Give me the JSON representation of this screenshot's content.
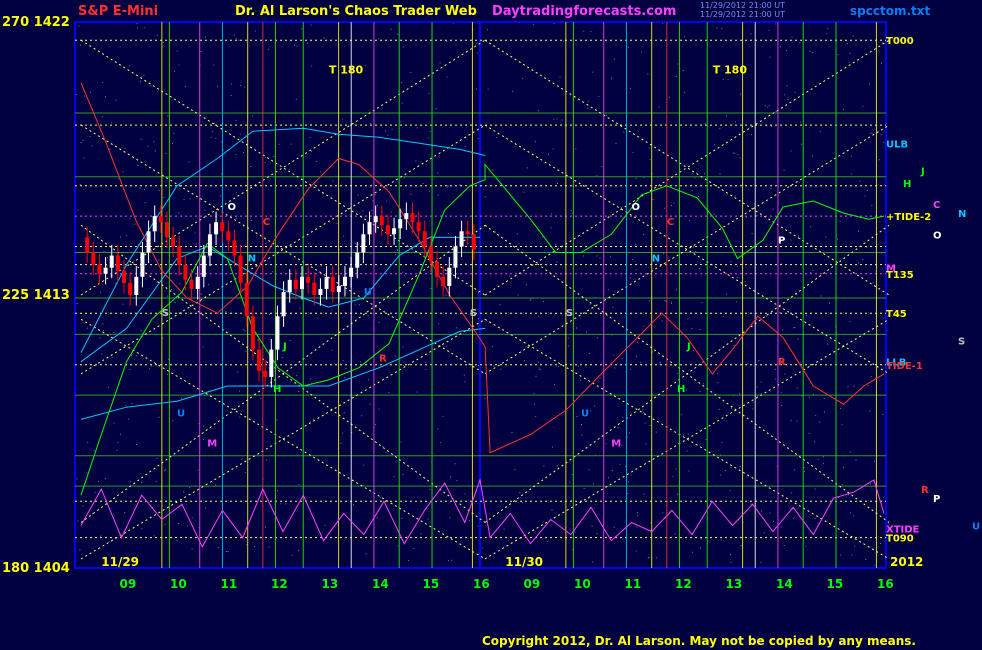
{
  "header": {
    "instrument": "S&P E-Mini",
    "title": "Dr. Al Larson's Chaos Trader Web",
    "site": "Daytradingforecasts.com",
    "file": "spcctom.txt",
    "timestamp1": "11/29/2012 21:00 UT",
    "timestamp2": "11/29/2012 21:00 UT"
  },
  "footer": {
    "copyright": "Copyright 2012, Dr. Al Larson. May not be copied by any means."
  },
  "colors": {
    "bg": "#000040",
    "frame": "#0000ff",
    "price": "#ffffff",
    "down": "#ff0000",
    "title": "#ffff00",
    "instrument": "#ff3030",
    "site": "#ff40ff"
  },
  "chart_data": {
    "type": "candlestick",
    "y_axis_labels": [
      {
        "label": "270  1422",
        "value": 1422
      },
      {
        "label": "225  1413",
        "value": 1413
      },
      {
        "label": "180  1404",
        "value": 1404
      }
    ],
    "ylim": [
      1404,
      1422
    ],
    "x_hours": [
      {
        "label": "09",
        "day": 0,
        "hour": 9
      },
      {
        "label": "10",
        "day": 0,
        "hour": 10
      },
      {
        "label": "11",
        "day": 0,
        "hour": 11
      },
      {
        "label": "12",
        "day": 0,
        "hour": 12
      },
      {
        "label": "13",
        "day": 0,
        "hour": 13
      },
      {
        "label": "14",
        "day": 0,
        "hour": 14
      },
      {
        "label": "15",
        "day": 0,
        "hour": 15
      },
      {
        "label": "16",
        "day": 0,
        "hour": 16
      },
      {
        "label": "09",
        "day": 1,
        "hour": 9
      },
      {
        "label": "10",
        "day": 1,
        "hour": 10
      },
      {
        "label": "11",
        "day": 1,
        "hour": 11
      },
      {
        "label": "12",
        "day": 1,
        "hour": 12
      },
      {
        "label": "13",
        "day": 1,
        "hour": 13
      },
      {
        "label": "14",
        "day": 1,
        "hour": 14
      },
      {
        "label": "15",
        "day": 1,
        "hour": 15
      },
      {
        "label": "16",
        "day": 1,
        "hour": 16
      }
    ],
    "dates": [
      {
        "label": "11/29",
        "day": 0
      },
      {
        "label": "11/30",
        "day": 1
      }
    ],
    "year": "2012",
    "right_labels": [
      {
        "label": "T000",
        "value": 1421.4,
        "color": "#ffff00"
      },
      {
        "label": "ULB",
        "value": 1418.0,
        "color": "#00c8ff"
      },
      {
        "label": "+TIDE-2",
        "value": 1415.6,
        "color": "#ffff00"
      },
      {
        "label": "M",
        "value": 1413.9,
        "color": "#ff40ff"
      },
      {
        "label": "T135",
        "value": 1413.7,
        "color": "#ffff00"
      },
      {
        "label": "T45",
        "value": 1412.4,
        "color": "#ffff00"
      },
      {
        "label": "LLB",
        "value": 1410.8,
        "color": "#00c8ff"
      },
      {
        "label": "TIDE-1",
        "value": 1410.7,
        "color": "#ff3030"
      },
      {
        "label": "XTIDE",
        "value": 1405.3,
        "color": "#ff40ff"
      },
      {
        "label": "T090",
        "value": 1405.0,
        "color": "#ffff00"
      }
    ],
    "side_letters": [
      {
        "label": "J",
        "value": 1417.1,
        "color": "#00ff00",
        "col": 1
      },
      {
        "label": "H",
        "value": 1416.7,
        "color": "#00ff00",
        "col": 0
      },
      {
        "label": "C",
        "value": 1416.0,
        "color": "#ff40ff",
        "col": 2
      },
      {
        "label": "N",
        "value": 1415.7,
        "color": "#00c8ff",
        "col": 3
      },
      {
        "label": "O",
        "value": 1415.0,
        "color": "#ffffff",
        "col": 2
      },
      {
        "label": "S",
        "value": 1411.5,
        "color": "#c0c0c0",
        "col": 3
      },
      {
        "label": "R",
        "value": 1406.6,
        "color": "#ff3030",
        "col": 1
      },
      {
        "label": "P",
        "value": 1406.3,
        "color": "#ffffff",
        "col": 2
      },
      {
        "label": "U",
        "value": 1405.4,
        "color": "#0080ff",
        "col": 4
      }
    ],
    "t_markers": [
      {
        "label": "T  180",
        "day": 0,
        "hour": 13.8,
        "value": 1420.3
      },
      {
        "label": "T  180",
        "day": 1,
        "hour": 13.4,
        "value": 1420.3
      }
    ],
    "planet_markers": [
      {
        "label": "O",
        "day": 0,
        "hour": 11.0,
        "value": 1415.8,
        "color": "#ffffff"
      },
      {
        "label": "C",
        "day": 0,
        "hour": 11.7,
        "value": 1415.3,
        "color": "#ff3030"
      },
      {
        "label": "N",
        "day": 0,
        "hour": 11.4,
        "value": 1414.1,
        "color": "#00c8ff"
      },
      {
        "label": "S",
        "day": 0,
        "hour": 9.7,
        "value": 1412.3,
        "color": "#c0c0c0"
      },
      {
        "label": "U",
        "day": 0,
        "hour": 13.7,
        "value": 1413.0,
        "color": "#0080ff"
      },
      {
        "label": "J",
        "day": 0,
        "hour": 12.1,
        "value": 1411.2,
        "color": "#00ff00"
      },
      {
        "label": "H",
        "day": 0,
        "hour": 11.9,
        "value": 1409.8,
        "color": "#00ff00"
      },
      {
        "label": "R",
        "day": 0,
        "hour": 14.0,
        "value": 1410.8,
        "color": "#ff3030"
      },
      {
        "label": "S",
        "day": 0,
        "hour": 15.8,
        "value": 1412.3,
        "color": "#c0c0c0"
      },
      {
        "label": "U",
        "day": 0,
        "hour": 10.0,
        "value": 1409.0,
        "color": "#0080ff"
      },
      {
        "label": "M",
        "day": 0,
        "hour": 10.6,
        "value": 1408.0,
        "color": "#ff40ff"
      },
      {
        "label": "O",
        "day": 1,
        "hour": 11.0,
        "value": 1415.8,
        "color": "#ffffff"
      },
      {
        "label": "C",
        "day": 1,
        "hour": 11.7,
        "value": 1415.3,
        "color": "#ff3030"
      },
      {
        "label": "N",
        "day": 1,
        "hour": 11.4,
        "value": 1414.1,
        "color": "#00c8ff"
      },
      {
        "label": "S",
        "day": 1,
        "hour": 9.7,
        "value": 1412.3,
        "color": "#c0c0c0"
      },
      {
        "label": "J",
        "day": 1,
        "hour": 12.1,
        "value": 1411.2,
        "color": "#00ff00"
      },
      {
        "label": "H",
        "day": 1,
        "hour": 11.9,
        "value": 1409.8,
        "color": "#00ff00"
      },
      {
        "label": "U",
        "day": 1,
        "hour": 10.0,
        "value": 1409.0,
        "color": "#0080ff"
      },
      {
        "label": "M",
        "day": 1,
        "hour": 10.6,
        "value": 1408.0,
        "color": "#ff40ff"
      },
      {
        "label": "P",
        "day": 1,
        "hour": 13.9,
        "value": 1414.7,
        "color": "#ffffff"
      },
      {
        "label": "R",
        "day": 1,
        "hour": 13.9,
        "value": 1410.7,
        "color": "#ff3030"
      }
    ],
    "prices": [
      1414.9,
      1414.4,
      1414.0,
      1413.7,
      1413.9,
      1414.3,
      1413.8,
      1413.4,
      1413.0,
      1413.6,
      1414.4,
      1415.1,
      1415.6,
      1415.4,
      1414.9,
      1414.6,
      1414.0,
      1413.5,
      1413.2,
      1413.6,
      1414.3,
      1415.0,
      1415.4,
      1415.1,
      1414.8,
      1414.3,
      1413.4,
      1412.3,
      1411.2,
      1410.5,
      1410.3,
      1411.2,
      1412.3,
      1413.1,
      1413.5,
      1413.2,
      1413.6,
      1413.4,
      1413.0,
      1413.2,
      1413.6,
      1413.1,
      1413.3,
      1413.6,
      1413.9,
      1414.4,
      1415.0,
      1415.4,
      1415.6,
      1415.3,
      1415.0,
      1415.2,
      1415.5,
      1415.7,
      1415.4,
      1415.1,
      1414.6,
      1414.1,
      1413.6,
      1413.3,
      1413.9,
      1414.6,
      1415.1,
      1415.0,
      1414.5
    ],
    "series": [
      {
        "name": "",
        "color": "#00c8ff",
        "points": [
          [
            0,
            8.1,
            1411.1
          ],
          [
            0,
            9.0,
            1414.0
          ],
          [
            0,
            10.0,
            1416.6
          ],
          [
            0,
            10.8,
            1417.5
          ],
          [
            0,
            11.5,
            1418.4
          ],
          [
            0,
            12.5,
            1418.5
          ],
          [
            0,
            13.2,
            1418.3
          ],
          [
            0,
            14.0,
            1418.2
          ],
          [
            0,
            14.8,
            1418.0
          ],
          [
            0,
            15.6,
            1417.8
          ],
          [
            0,
            16.1,
            1417.6
          ]
        ]
      },
      {
        "name": "",
        "color": "#00c8ff",
        "points": [
          [
            0,
            8.1,
            1410.8
          ],
          [
            0,
            9.0,
            1411.9
          ],
          [
            0,
            10.0,
            1414.2
          ],
          [
            0,
            10.6,
            1414.6
          ],
          [
            0,
            11.2,
            1414.0
          ],
          [
            0,
            11.9,
            1413.3
          ],
          [
            0,
            12.5,
            1412.9
          ],
          [
            0,
            13.0,
            1412.6
          ],
          [
            0,
            13.7,
            1412.9
          ],
          [
            0,
            14.4,
            1414.3
          ],
          [
            0,
            15.0,
            1414.9
          ],
          [
            0,
            16.0,
            1414.9
          ]
        ]
      },
      {
        "name": "",
        "color": "#00c8ff",
        "points": [
          [
            0,
            8.1,
            1408.9
          ],
          [
            0,
            9.0,
            1409.3
          ],
          [
            0,
            10.0,
            1409.5
          ],
          [
            0,
            11.0,
            1410.0
          ],
          [
            0,
            12.0,
            1410.0
          ],
          [
            0,
            13.0,
            1410.0
          ],
          [
            0,
            14.0,
            1410.6
          ],
          [
            0,
            14.8,
            1411.2
          ],
          [
            0,
            15.6,
            1411.8
          ],
          [
            0,
            16.1,
            1411.9
          ]
        ]
      },
      {
        "name": "",
        "color": "#ff3030",
        "points": [
          [
            0,
            8.1,
            1420.0
          ],
          [
            0,
            8.6,
            1418.0
          ],
          [
            0,
            9.2,
            1415.4
          ],
          [
            0,
            9.7,
            1413.8
          ],
          [
            0,
            10.2,
            1412.9
          ],
          [
            0,
            10.8,
            1412.4
          ],
          [
            0,
            11.4,
            1413.3
          ],
          [
            0,
            12.0,
            1415.0
          ],
          [
            0,
            12.6,
            1416.5
          ],
          [
            0,
            13.2,
            1417.5
          ],
          [
            0,
            13.6,
            1417.3
          ],
          [
            0,
            14.2,
            1416.4
          ],
          [
            0,
            14.8,
            1414.8
          ],
          [
            0,
            15.4,
            1413.0
          ],
          [
            0,
            15.9,
            1411.8
          ],
          [
            0,
            16.1,
            1411.3
          ],
          [
            1,
            8.2,
            1407.8
          ],
          [
            1,
            9.0,
            1408.4
          ],
          [
            1,
            9.7,
            1409.2
          ],
          [
            1,
            10.4,
            1410.4
          ],
          [
            1,
            11.0,
            1411.4
          ],
          [
            1,
            11.6,
            1412.4
          ],
          [
            1,
            12.1,
            1411.6
          ],
          [
            1,
            12.6,
            1410.4
          ],
          [
            1,
            13.0,
            1411.2
          ],
          [
            1,
            13.5,
            1412.3
          ],
          [
            1,
            14.0,
            1411.6
          ],
          [
            1,
            14.6,
            1410.0
          ],
          [
            1,
            15.2,
            1409.4
          ],
          [
            1,
            15.6,
            1410.0
          ],
          [
            1,
            16.0,
            1410.4
          ]
        ]
      },
      {
        "name": "",
        "color": "#00ff00",
        "points": [
          [
            0,
            8.1,
            1406.4
          ],
          [
            0,
            8.5,
            1408.4
          ],
          [
            0,
            9.0,
            1410.8
          ],
          [
            0,
            9.5,
            1412.2
          ],
          [
            0,
            10.1,
            1413.1
          ],
          [
            0,
            10.6,
            1414.7
          ],
          [
            0,
            11.0,
            1414.2
          ],
          [
            0,
            11.5,
            1411.9
          ],
          [
            0,
            12.0,
            1410.6
          ],
          [
            0,
            12.5,
            1410.0
          ],
          [
            0,
            13.0,
            1410.2
          ],
          [
            0,
            13.6,
            1410.6
          ],
          [
            0,
            14.2,
            1411.4
          ],
          [
            0,
            14.8,
            1413.7
          ],
          [
            0,
            15.3,
            1415.8
          ],
          [
            0,
            15.8,
            1416.6
          ],
          [
            0,
            16.1,
            1416.8
          ],
          [
            1,
            8.1,
            1417.3
          ],
          [
            1,
            8.5,
            1416.5
          ],
          [
            1,
            9.0,
            1415.5
          ],
          [
            1,
            9.5,
            1414.4
          ],
          [
            1,
            10.0,
            1414.4
          ],
          [
            1,
            10.6,
            1415.0
          ],
          [
            1,
            11.2,
            1416.3
          ],
          [
            1,
            11.7,
            1416.6
          ],
          [
            1,
            12.3,
            1416.2
          ],
          [
            1,
            12.8,
            1415.2
          ],
          [
            1,
            13.1,
            1414.2
          ],
          [
            1,
            13.6,
            1414.8
          ],
          [
            1,
            14.0,
            1415.9
          ],
          [
            1,
            14.6,
            1416.1
          ],
          [
            1,
            15.2,
            1415.7
          ],
          [
            1,
            15.7,
            1415.5
          ],
          [
            1,
            16.0,
            1415.6
          ]
        ]
      },
      {
        "name": "",
        "color": "#ff40ff",
        "points": [
          [
            0,
            8.1,
            1405.4
          ],
          [
            0,
            8.5,
            1406.6
          ],
          [
            0,
            8.9,
            1405.0
          ],
          [
            0,
            9.3,
            1406.4
          ],
          [
            0,
            9.7,
            1405.6
          ],
          [
            0,
            10.1,
            1406.1
          ],
          [
            0,
            10.5,
            1404.7
          ],
          [
            0,
            10.9,
            1405.9
          ],
          [
            0,
            11.3,
            1405.0
          ],
          [
            0,
            11.7,
            1406.6
          ],
          [
            0,
            12.1,
            1405.2
          ],
          [
            0,
            12.5,
            1406.4
          ],
          [
            0,
            12.9,
            1404.9
          ],
          [
            0,
            13.3,
            1405.8
          ],
          [
            0,
            13.7,
            1405.1
          ],
          [
            0,
            14.1,
            1406.2
          ],
          [
            0,
            14.5,
            1404.8
          ],
          [
            0,
            14.9,
            1405.9
          ],
          [
            0,
            15.3,
            1406.8
          ],
          [
            0,
            15.7,
            1405.5
          ],
          [
            0,
            16.0,
            1406.9
          ],
          [
            1,
            8.2,
            1405.0
          ],
          [
            1,
            8.6,
            1405.8
          ],
          [
            1,
            9.0,
            1404.8
          ],
          [
            1,
            9.4,
            1405.6
          ],
          [
            1,
            9.8,
            1405.1
          ],
          [
            1,
            10.2,
            1406.0
          ],
          [
            1,
            10.6,
            1404.9
          ],
          [
            1,
            11.0,
            1405.5
          ],
          [
            1,
            11.4,
            1405.2
          ],
          [
            1,
            11.8,
            1405.9
          ],
          [
            1,
            12.2,
            1405.1
          ],
          [
            1,
            12.6,
            1406.2
          ],
          [
            1,
            13.0,
            1405.4
          ],
          [
            1,
            13.4,
            1406.1
          ],
          [
            1,
            13.8,
            1405.2
          ],
          [
            1,
            14.2,
            1406.0
          ],
          [
            1,
            14.6,
            1405.1
          ],
          [
            1,
            15.0,
            1406.3
          ],
          [
            1,
            15.4,
            1406.5
          ],
          [
            1,
            15.8,
            1406.9
          ],
          [
            1,
            16.0,
            1405.8
          ]
        ]
      }
    ]
  }
}
